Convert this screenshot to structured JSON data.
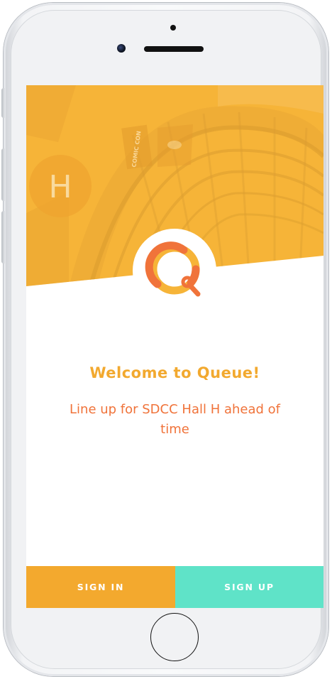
{
  "app": {
    "welcome_title": "Welcome to Queue!",
    "tagline": "Line up for SDCC Hall H ahead of time",
    "hero_sign_letter": "H",
    "hero_banner_text": "COMIC CON"
  },
  "actions": {
    "sign_in_label": "SIGN IN",
    "sign_up_label": "SIGN UP"
  },
  "icons": {
    "logo": "queue-q-logo-icon"
  },
  "colors": {
    "hero_overlay": "#f6b438",
    "welcome_title": "#f2a92f",
    "tagline": "#f0733a",
    "sign_in": "#f3a92e",
    "sign_up": "#5fe3c8",
    "logo_orange": "#f0733a",
    "logo_yellow": "#f6b438"
  }
}
